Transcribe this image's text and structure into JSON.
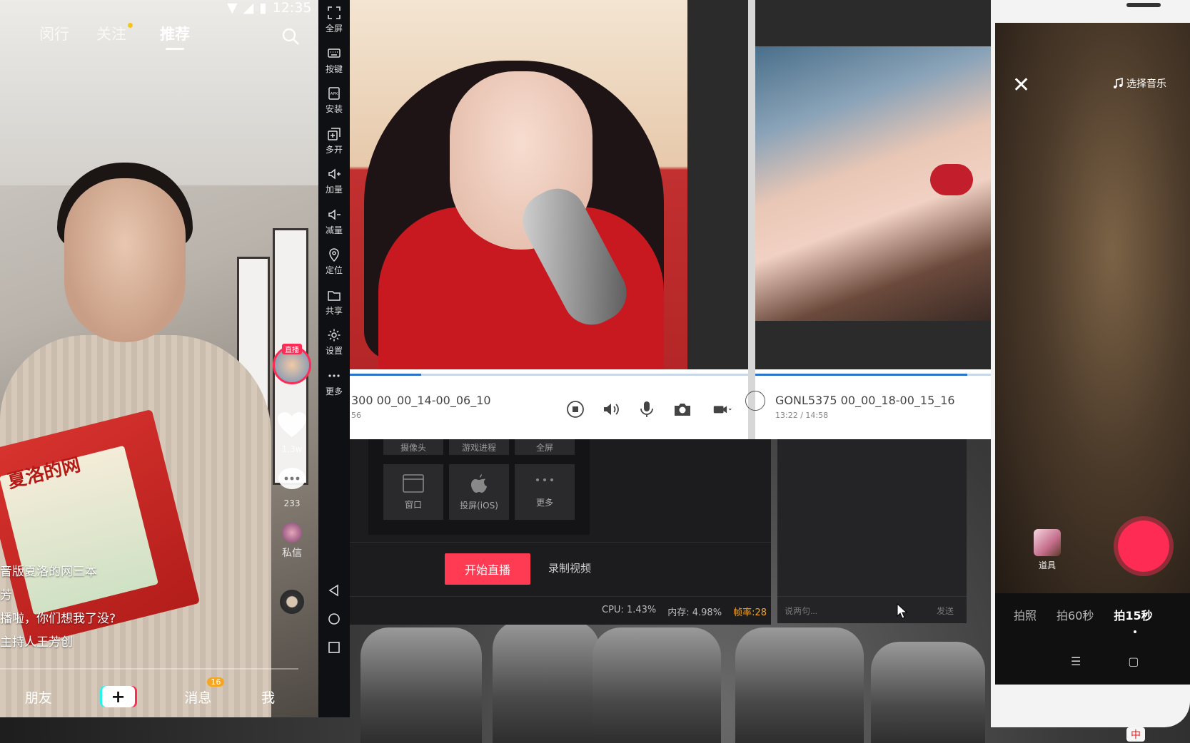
{
  "phone_left": {
    "status_time": "12:35",
    "tabs": [
      {
        "label": "闵行",
        "active": false
      },
      {
        "label": "关注",
        "active": false,
        "dot": true
      },
      {
        "label": "推荐",
        "active": true
      }
    ],
    "live_tag": "直播",
    "like_count": "1.3w",
    "comment_count": "233",
    "dm_label": "私信",
    "caption": {
      "line1": "音版夏洛的网三本",
      "line2": "芳",
      "line3": "播啦，你们想我了没?",
      "line4": "主持人王芳创"
    },
    "nav": {
      "friends": "朋友",
      "plus": "+",
      "messages": "消息",
      "messages_badge": "16",
      "me": "我"
    },
    "book_title": "夏洛的网"
  },
  "toolbar": {
    "items": [
      {
        "label": "全屏",
        "icon": "fullscreen-icon"
      },
      {
        "label": "按键",
        "icon": "keyboard-icon"
      },
      {
        "label": "安装",
        "icon": "apk-icon"
      },
      {
        "label": "多开",
        "icon": "multi-window-icon"
      },
      {
        "label": "加量",
        "icon": "volume-up-icon"
      },
      {
        "label": "减量",
        "icon": "volume-down-icon"
      },
      {
        "label": "定位",
        "icon": "location-icon"
      },
      {
        "label": "共享",
        "icon": "folder-icon"
      },
      {
        "label": "设置",
        "icon": "gear-icon"
      },
      {
        "label": "更多",
        "icon": "more-icon"
      }
    ]
  },
  "player1": {
    "title": "300 00_00_14-00_06_10",
    "time": "56",
    "progress": 0.18
  },
  "player2": {
    "title": "GONL5375 00_00_18-00_15_16",
    "time": "13:22 / 14:58",
    "progress": 0.9
  },
  "stream_app": {
    "source_tabs": [
      "摄像头",
      "游戏进程",
      "全屏"
    ],
    "source_tiles": [
      "窗口",
      "投屏(iOS)",
      "更多"
    ],
    "start_live": "开始直播",
    "record_video": "录制视频",
    "cpu": "CPU: 1.43%",
    "mem": "内存: 4.98%",
    "fps": "帧率:28",
    "chat_placeholder": "说两句...",
    "chat_send": "发送"
  },
  "phone_right": {
    "music_label": "选择音乐",
    "props_label": "道具",
    "modes": [
      {
        "label": "拍照",
        "active": false
      },
      {
        "label": "拍60秒",
        "active": false
      },
      {
        "label": "拍15秒",
        "active": true
      }
    ]
  },
  "ime_label": "中"
}
